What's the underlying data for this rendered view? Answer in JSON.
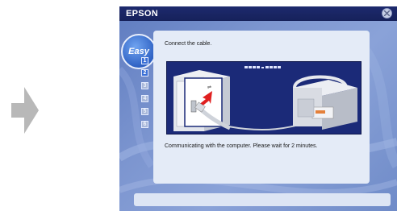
{
  "window": {
    "title": "EPSON"
  },
  "sidebar": {
    "badge_label": "Easy",
    "steps": [
      "1",
      "2",
      "3",
      "4",
      "5",
      "6"
    ],
    "active_steps": [
      1,
      2
    ]
  },
  "main": {
    "instruction": "Connect the cable.",
    "status": "Communicating with the computer. Please wait for 2 minutes."
  },
  "icons": {
    "close": "close-icon",
    "arrow": "next-arrow-icon"
  },
  "colors": {
    "titlebar": "#1d2a6e",
    "accent": "#3a6fd6",
    "illustration_bg": "#1b2a78",
    "cable_arrow": "#e02020"
  }
}
